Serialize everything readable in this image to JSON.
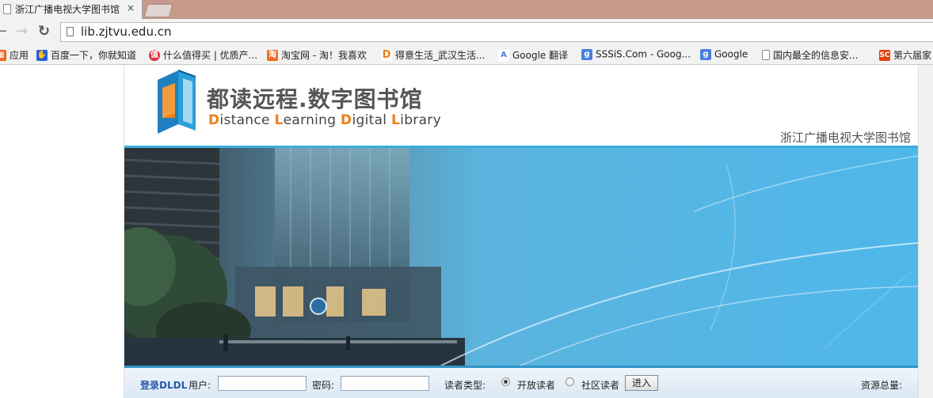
{
  "browser": {
    "tab_title": "浙江广播电视大学图书馆",
    "tab_close": "×",
    "url": "lib.zjtvu.edu.cn"
  },
  "bookmarks": [
    {
      "label": "应用",
      "icon": "apps-grid-icon",
      "color": "#e8651a"
    },
    {
      "label": "百度一下，你就知道",
      "icon": "baidu-paw-icon",
      "color": "#2b5dd8"
    },
    {
      "label": "什么值得买 | 优质产...",
      "icon": "smzdm-icon",
      "color": "#d9363e"
    },
    {
      "label": "淘宝网 - 淘！我喜欢",
      "icon": "taobao-icon",
      "color": "#f36c21"
    },
    {
      "label": "得意生活_武汉生活...",
      "icon": "deyi-d-icon",
      "color": "#f07b16"
    },
    {
      "label": "Google 翻译",
      "icon": "google-translate-icon",
      "color": "#4a7fe0"
    },
    {
      "label": "SSSiS.Com - Goog...",
      "icon": "google-g-icon",
      "color": "#4a7fe0"
    },
    {
      "label": "Google",
      "icon": "google-g-icon",
      "color": "#4a7fe0"
    },
    {
      "label": "国内最全的信息安...",
      "icon": "page-icon",
      "color": "#ffffff"
    },
    {
      "label": "第六届家",
      "icon": "sc-icon",
      "color": "#e2400f"
    }
  ],
  "header": {
    "title_cn": "都读远程.数字图书馆",
    "title_en": [
      {
        "cap": "D",
        "rest": "istance "
      },
      {
        "cap": "L",
        "rest": "earning "
      },
      {
        "cap": "D",
        "rest": "igital "
      },
      {
        "cap": "L",
        "rest": "ibrary"
      }
    ],
    "university": "浙江广播电视大学图书馆"
  },
  "login": {
    "brand": "登录DLDL",
    "user_label": "用户:",
    "user_value": "",
    "password_label": "密码:",
    "password_value": "",
    "reader_type_label": "读者类型:",
    "options": [
      {
        "label": "开放读者",
        "checked": true
      },
      {
        "label": "社区读者",
        "checked": false
      }
    ],
    "submit": "进入",
    "resource_total": "资源总量:"
  },
  "colors": {
    "accent_blue": "#3aaedd",
    "logo_orange": "#e8821e",
    "tabstrip": "#c6998b"
  }
}
